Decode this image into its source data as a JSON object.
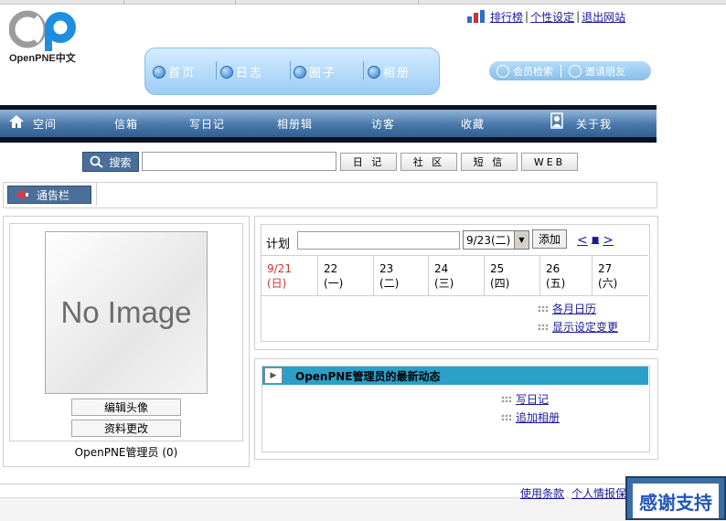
{
  "brand": {
    "name": "OpenPNE中文"
  },
  "top_links": {
    "ranking": "排行榜",
    "settings": "个性设定",
    "logout": "退出网站"
  },
  "nav_pill": [
    "首页",
    "日志",
    "圈子",
    "相册"
  ],
  "member_pill": {
    "search": "会员检索",
    "invite": "邀请朋友"
  },
  "main_nav": [
    "空间",
    "信箱",
    "写日记",
    "相册辑",
    "访客",
    "收藏",
    "关于我"
  ],
  "search": {
    "button": "搜索",
    "value": "",
    "scopes": [
      "日 记",
      "社 区",
      "短 信",
      "WEB"
    ]
  },
  "notice": {
    "label": "通告栏"
  },
  "profile": {
    "image_text": "No Image",
    "edit_avatar": "编辑头像",
    "edit_profile": "资料更改",
    "name_line": "OpenPNE管理员 (0)"
  },
  "calendar": {
    "label": "计划",
    "input_value": "",
    "select_value": "9/23(二)",
    "add_button": "添加",
    "nav_prev": "<",
    "nav_now": "■",
    "nav_next": ">",
    "days": [
      {
        "date": "9/21",
        "weekday": "(日)",
        "color": "#cc3333"
      },
      {
        "date": "22",
        "weekday": "(一)",
        "color": "#000000"
      },
      {
        "date": "23",
        "weekday": "(二)",
        "color": "#000000"
      },
      {
        "date": "24",
        "weekday": "(三)",
        "color": "#000000"
      },
      {
        "date": "25",
        "weekday": "(四)",
        "color": "#000000"
      },
      {
        "date": "26",
        "weekday": "(五)",
        "color": "#000000"
      },
      {
        "date": "27",
        "weekday": "(六)",
        "color": "#000000"
      }
    ],
    "monthly": "各月日历",
    "display_settings": "显示设定变更"
  },
  "news": {
    "title": "OpenPNE管理员的最新动态",
    "write_diary": "写日记",
    "add_album": "追加相册"
  },
  "footer": {
    "terms": "使用条款",
    "privacy": "个人情报保"
  },
  "thanks": "感谢支持",
  "colors": {
    "nav_dark": "#0a1222",
    "nav_blue": "#4a78aa",
    "accent_cyan": "#2aa0c8",
    "link": "#1a1a99"
  }
}
